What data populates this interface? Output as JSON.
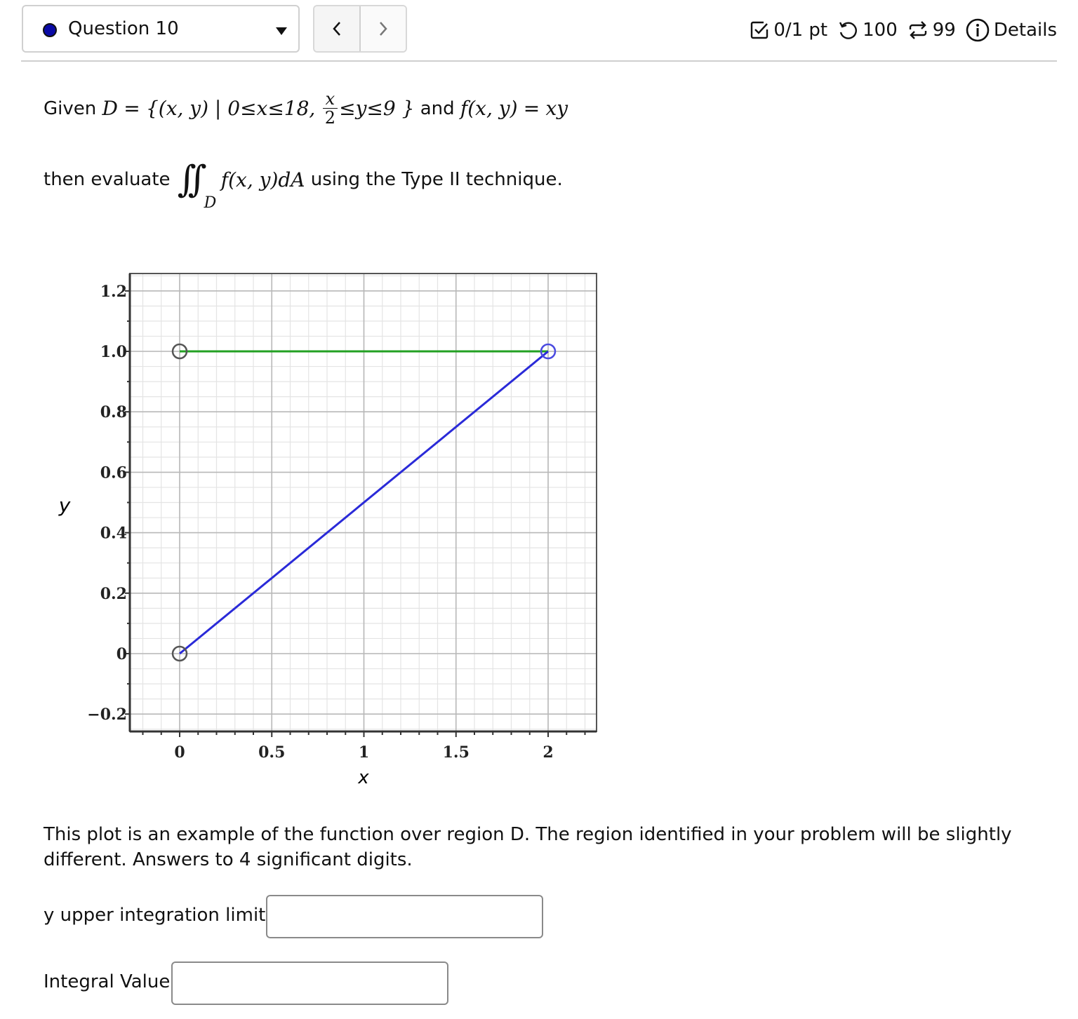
{
  "header": {
    "question_label": "Question 10",
    "question_status_color": "#0a0aa6",
    "prev_label": "<",
    "next_label": ">",
    "score": "0/1 pt",
    "score_icon": "checkbox-icon",
    "retries": "100",
    "retries_icon": "undo-icon",
    "attempts": "99",
    "attempts_icon": "repeat-icon",
    "details_label": "Details",
    "details_icon": "info-icon"
  },
  "problem": {
    "given_prefix": "Given",
    "D": "D",
    "equals": "=",
    "set_open": "{(x, y) | 0≤x≤18,",
    "frac_num": "x",
    "frac_den": "2",
    "set_close": "≤y≤9 }",
    "and_text": "and",
    "f_def": "f(x, y)",
    "f_equals": "=",
    "f_expr": "xy",
    "evaluate_prefix": "then evaluate",
    "integral_symbol": "∬",
    "integral_sub": "D",
    "integrand": "f(x, y)dA",
    "evaluate_suffix": "using the Type II technique."
  },
  "chart_data": {
    "type": "line",
    "title": "",
    "xlabel": "x",
    "ylabel": "y",
    "xlim": [
      -0.27,
      2.26
    ],
    "ylim": [
      -0.26,
      1.26
    ],
    "x_ticks": [
      0,
      0.5,
      1,
      1.5,
      2
    ],
    "x_tick_labels": [
      "0",
      "0.5",
      "1",
      "1.5",
      "2"
    ],
    "y_ticks": [
      -0.2,
      0,
      0.2,
      0.4,
      0.6,
      0.8,
      1.0,
      1.2
    ],
    "y_tick_labels": [
      "−0.2",
      "0",
      "0.2",
      "0.4",
      "0.6",
      "0.8",
      "1.0",
      "1.2"
    ],
    "grid": true,
    "series": [
      {
        "name": "upper boundary y=1",
        "color": "#22a022",
        "points": [
          [
            0,
            1
          ],
          [
            2,
            1
          ]
        ]
      },
      {
        "name": "lower boundary y=x/2",
        "color": "#2a2ad8",
        "points": [
          [
            0,
            0
          ],
          [
            2,
            1
          ]
        ]
      }
    ],
    "markers": [
      {
        "x": 0,
        "y": 1,
        "color": "#555555"
      },
      {
        "x": 0,
        "y": 0,
        "color": "#555555"
      },
      {
        "x": 2,
        "y": 1,
        "color": "#4a4ae0"
      }
    ]
  },
  "note": {
    "text": "This plot is an example of the function over region D.  The region identified in your problem will be slightly different. Answers to  4 significant digits."
  },
  "inputs": {
    "y_upper_label": "y upper integration limit",
    "y_upper_value": "",
    "integral_label": "Integral Value",
    "integral_value": ""
  }
}
